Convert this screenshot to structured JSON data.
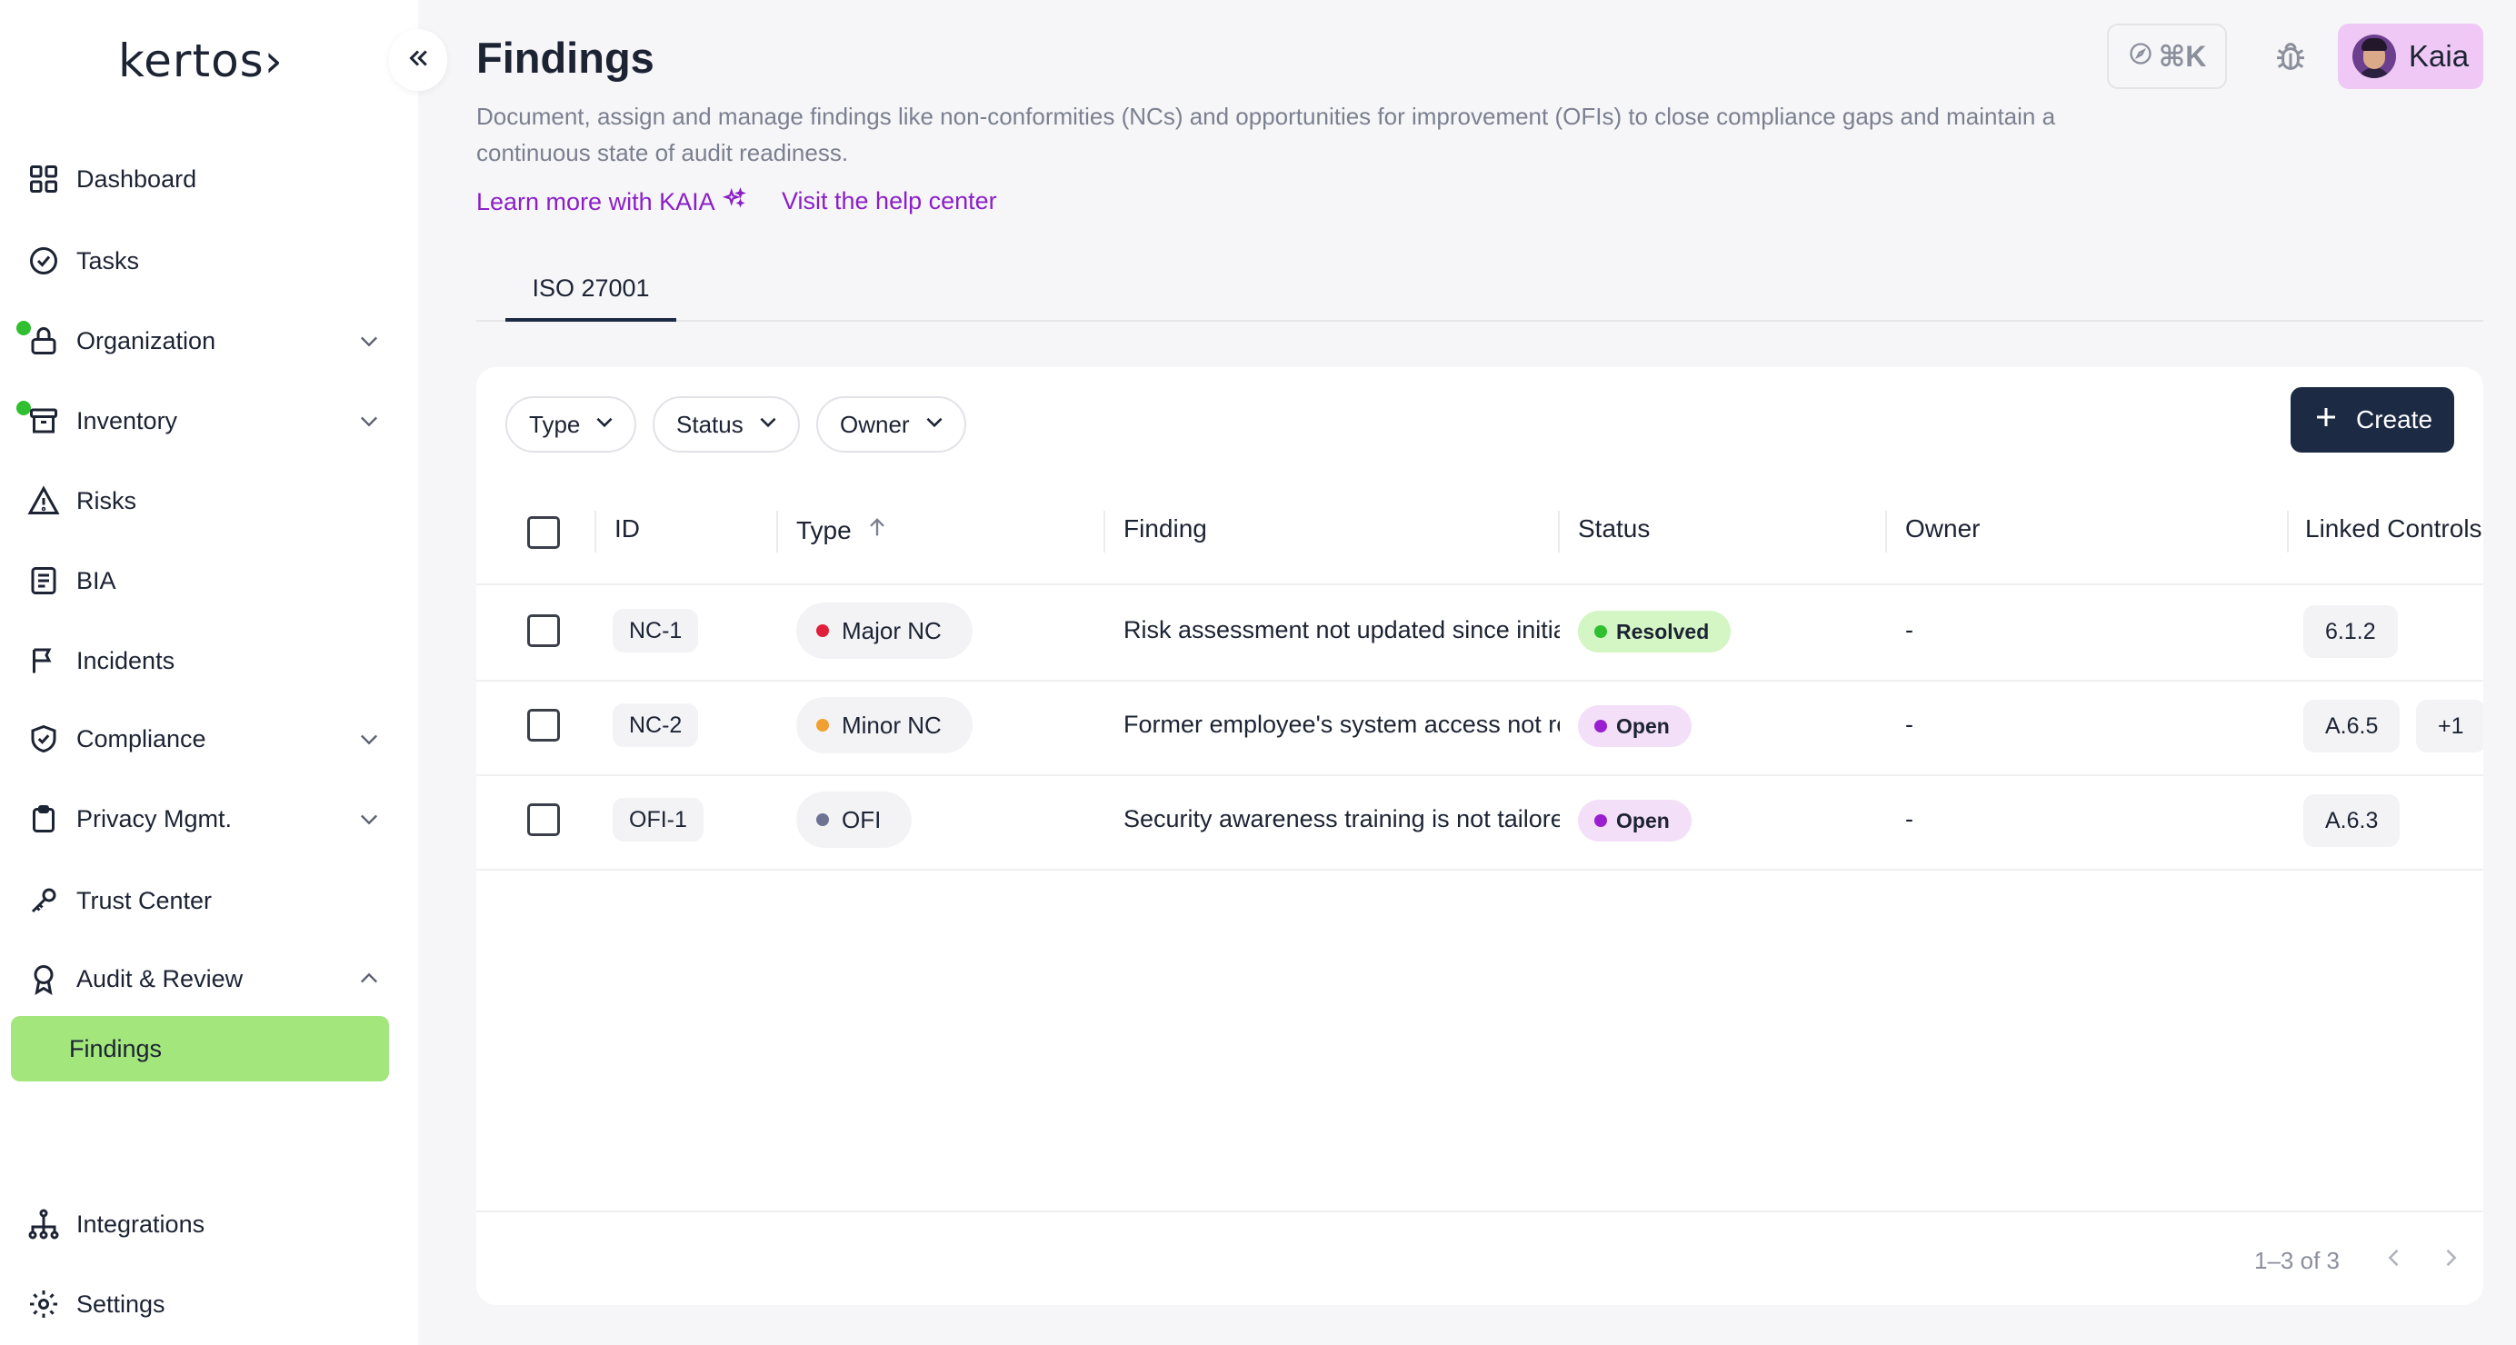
{
  "app": {
    "logo_text": "kertos›"
  },
  "sidebar": {
    "items": [
      {
        "label": "Dashboard",
        "icon": "grid-icon"
      },
      {
        "label": "Tasks",
        "icon": "check-circle-icon"
      },
      {
        "label": "Organization",
        "icon": "lock-icon",
        "expandable": true,
        "notification_dot": true
      },
      {
        "label": "Inventory",
        "icon": "archive-icon",
        "expandable": true,
        "notification_dot": true
      },
      {
        "label": "Risks",
        "icon": "warning-icon"
      },
      {
        "label": "BIA",
        "icon": "document-icon"
      },
      {
        "label": "Incidents",
        "icon": "flag-icon"
      },
      {
        "label": "Compliance",
        "icon": "shield-check-icon",
        "expandable": true
      },
      {
        "label": "Privacy Mgmt.",
        "icon": "clipboard-icon",
        "expandable": true
      },
      {
        "label": "Trust Center",
        "icon": "key-icon"
      },
      {
        "label": "Audit & Review",
        "icon": "award-icon",
        "expandable": true,
        "expanded": true
      }
    ],
    "active_subitem": "Findings",
    "bottom_items": [
      {
        "label": "Integrations",
        "icon": "hierarchy-icon"
      },
      {
        "label": "Settings",
        "icon": "gear-icon"
      }
    ],
    "accent_active": "#a3e67c",
    "dot_color": "#2fbf2f"
  },
  "header": {
    "title": "Findings",
    "description": "Document, assign and manage findings like non-conformities (NCs) and opportunities for improvement (OFIs) to close compliance gaps and maintain a continuous state of audit readiness.",
    "link_kaia": "Learn more with KAIA",
    "link_help": "Visit the help center",
    "shortcut_label": "⌘K",
    "user_name": "Kaia",
    "link_color": "#8b1fc7"
  },
  "tabs": [
    {
      "label": "ISO 27001",
      "active": true
    }
  ],
  "filters": {
    "type": "Type",
    "status": "Status",
    "owner": "Owner"
  },
  "create_label": "Create",
  "table": {
    "headers": {
      "id": "ID",
      "type": "Type",
      "finding": "Finding",
      "status": "Status",
      "owner": "Owner",
      "controls": "Linked Controls"
    },
    "rows": [
      {
        "id": "NC-1",
        "type": "Major NC",
        "type_color": "#e0203a",
        "finding": "Risk assessment not updated since initial setup",
        "status": "Resolved",
        "status_dot": "#2fbf2f",
        "status_bg": "#d4f5c4",
        "owner": "-",
        "controls": [
          "6.1.2"
        ]
      },
      {
        "id": "NC-2",
        "type": "Minor NC",
        "type_color": "#f0a030",
        "finding": "Former employee's system access not revoked",
        "status": "Open",
        "status_dot": "#9b1fd0",
        "status_bg": "#f4dff8",
        "owner": "-",
        "controls": [
          "A.6.5",
          "+1"
        ]
      },
      {
        "id": "OFI-1",
        "type": "OFI",
        "type_color": "#6d7390",
        "finding": "Security awareness training is not tailored to roles",
        "status": "Open",
        "status_dot": "#9b1fd0",
        "status_bg": "#f4dff8",
        "owner": "-",
        "controls": [
          "A.6.3"
        ]
      }
    ]
  },
  "pagination": {
    "label": "1–3 of 3"
  }
}
